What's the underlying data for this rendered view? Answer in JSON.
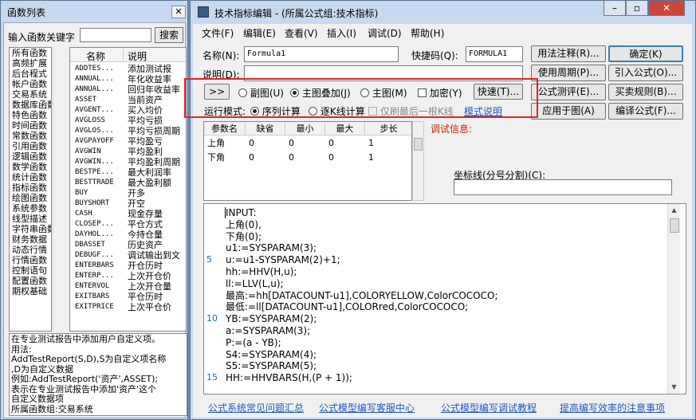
{
  "left_window": {
    "title": "函数列表",
    "search_label": "输入函数关键字",
    "search_button": "搜索",
    "col_name": "名称",
    "col_desc": "说明",
    "categories": [
      "所有函数",
      "高频扩展",
      "后台程式",
      "帐户函数",
      "交易系统",
      "数据库函数",
      "特色函数",
      "时间函数",
      "常数函数",
      "引用函数",
      "逻辑函数",
      "数学函数",
      "统计函数",
      "指标函数",
      "绘图函数",
      "系统参数",
      "线型描述",
      "字符串函数",
      "财务数据",
      "动态行情",
      "行情函数",
      "控制语句",
      "配置函数",
      "期权基础"
    ],
    "functions": [
      [
        "ADDTES...",
        "添加测试报"
      ],
      [
        "ANNUAL...",
        "年化收益率"
      ],
      [
        "ANNUAL...",
        "回归年收益率"
      ],
      [
        "ASSET",
        "当前资产"
      ],
      [
        "AVGENT...",
        "买入均价"
      ],
      [
        "AVGLOSS",
        "平均亏损"
      ],
      [
        "AVGLOS...",
        "平均亏损周期"
      ],
      [
        "AVGPAYOFF",
        "平均盈亏"
      ],
      [
        "AVGWIN",
        "平均盈利"
      ],
      [
        "AVGWIN...",
        "平均盈利周期"
      ],
      [
        "BESTPE...",
        "最大利润率"
      ],
      [
        "BESTTRADE",
        "最大盈利额"
      ],
      [
        "BUY",
        "开多"
      ],
      [
        "BUYSHORT",
        "开空"
      ],
      [
        "CASH",
        "现金存量"
      ],
      [
        "CLOSEP...",
        "平仓方式"
      ],
      [
        "DAYHOL...",
        "今持仓量"
      ],
      [
        "DBASSET",
        "历史资产"
      ],
      [
        "DEBUGF...",
        "调试输出到文"
      ],
      [
        "ENTERBARS",
        "开仓历时"
      ],
      [
        "ENTERP...",
        "上次开仓价"
      ],
      [
        "ENTERVOL",
        "上次开仓量"
      ],
      [
        "EXITBARS",
        "平仓历时"
      ],
      [
        "EXITPRICE",
        "上次平仓价"
      ]
    ],
    "description": "在专业测试报告中添加用户自定义项。\n用法:\nAddTestReport(S,D),S为自定义项名称\n,D为自定义数据\n例如:AddTestReport('资产',ASSET);\n表示在专业测试报告中添加'资产'这个\n自定义数据项\n所属函数组:交易系统"
  },
  "window": {
    "title": "技术指标编辑 - (所属公式组:技术指标)"
  },
  "menu": [
    "文件(F)",
    "编辑(E)",
    "查看(V)",
    "插入(I)",
    "调试(D)",
    "帮助(H)"
  ],
  "form": {
    "name_label": "名称(N):",
    "name_value": "Formula1",
    "shortcut_label": "快捷码(Q):",
    "shortcut_value": "FORMULA1",
    "desc_label": "说明(D):"
  },
  "buttons": {
    "usage_note": "用法注释(R)...",
    "ok": "确定(K)",
    "use_period": "使用周期(P)...",
    "import_formula": "引入公式(O)...",
    "formula_eval": "公式测评(E)...",
    "buy_sell_rules": "买卖规则(B)...",
    "apply_chart": "应用于图(A)",
    "compile": "编译公式(F)..."
  },
  "options": {
    "expand": ">>",
    "sub_chart": "副图(U)",
    "main_overlay": "主图叠加(J)",
    "main_chart": "主图(M)",
    "encrypt": "加密(Y)",
    "quick": "快速(T)...",
    "run_mode_label": "运行模式:",
    "seq_calc": "序列计算",
    "tick_calc": "逐K线计算",
    "refresh_last": "仅刷最后一根K线",
    "mode_help": "模式说明"
  },
  "params": {
    "headers": [
      "参数名",
      "缺省",
      "最小",
      "最大",
      "步长"
    ],
    "rows": [
      [
        "上角",
        "0",
        "0",
        "0",
        "1"
      ],
      [
        "下角",
        "0",
        "0",
        "0",
        "1"
      ]
    ]
  },
  "debug_label": "调试信息:",
  "coord_label": "坐标线(分号分割)(C):",
  "code": {
    "line_numbers": [
      "5",
      "10",
      "15"
    ],
    "lines": [
      "INPUT:",
      "上角(0),",
      "下角(0);",
      "u1:=SYSPARAM(3);",
      "u:=u1-SYSPARAM(2)+1;",
      "hh:=HHV(H,u);",
      "ll:=LLV(L,u);",
      "最高:=hh[DATACOUNT-u1],COLORYELLOW,ColorCOCOCO;",
      "最低:=ll[DATACOUNT-u1],COLORred,ColorCOCOCO;",
      "YB:=SYSPARAM(2);",
      "a:=SYSPARAM(3);",
      "P:=(a - YB);",
      "S4:=SYSPARAM(4);",
      "S5:=SYSPARAM(5);",
      "HH:=HHVBARS(H,(P + 1));"
    ]
  },
  "footer_links": [
    "公式系统常见问题汇总",
    "公式模型编写客服中心",
    "公式模型编写调试教程",
    "提高编写效率的注意事项"
  ],
  "colors": {
    "highlight_border": "#e0242b",
    "debug_text": "#cc2200",
    "link": "#1f58c8"
  }
}
